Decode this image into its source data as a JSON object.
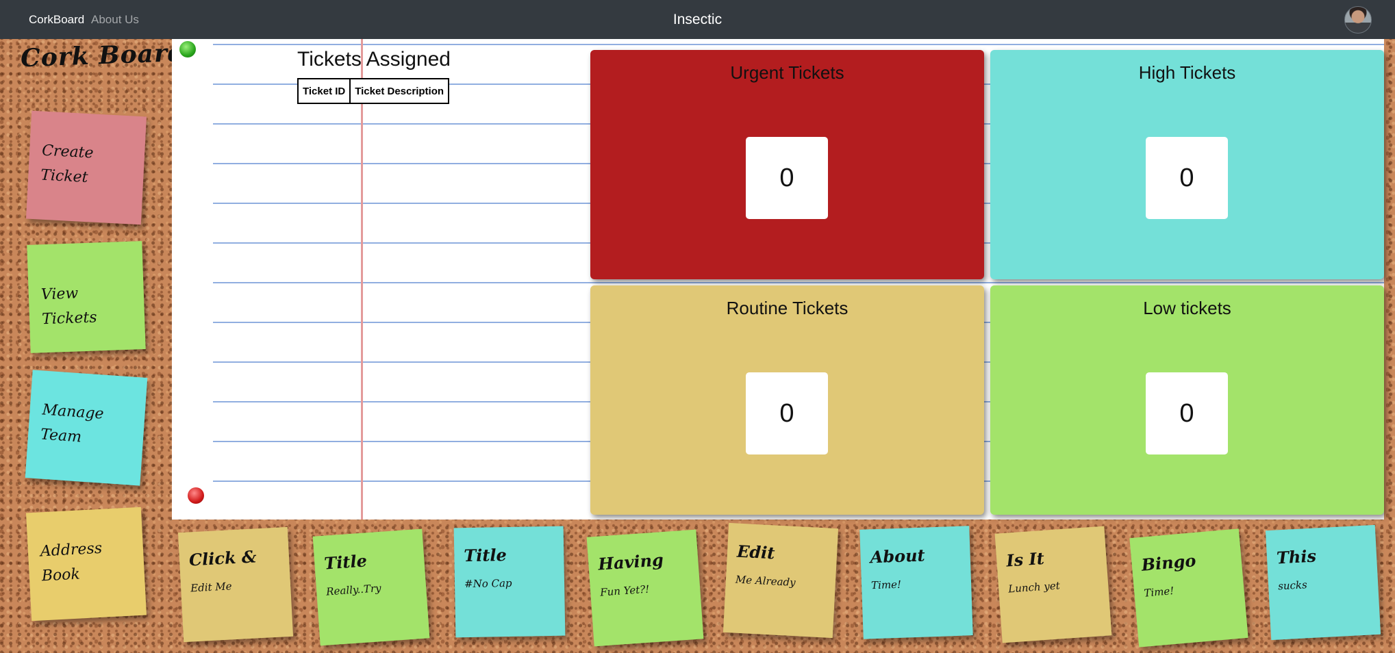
{
  "navbar": {
    "brand": "CorkBoard",
    "about": "About Us",
    "title": "Insectic"
  },
  "sidebar": {
    "title": "Cork Board",
    "notes": [
      {
        "label": "Create Ticket",
        "color": "#d9848a"
      },
      {
        "label": "View Tickets",
        "color": "#a3e36a"
      },
      {
        "label": "Manage Team",
        "color": "#6ce4e0"
      },
      {
        "label": "Address Book",
        "color": "#e8cd6c"
      }
    ]
  },
  "assigned": {
    "title": "Tickets Assigned",
    "columns": [
      "Ticket ID",
      "Ticket Description"
    ]
  },
  "priorities": [
    {
      "label": "Urgent Tickets",
      "count": "0",
      "color": "#b31d1f"
    },
    {
      "label": "High Tickets",
      "count": "0",
      "color": "#74e0d8"
    },
    {
      "label": "Routine Tickets",
      "count": "0",
      "color": "#e0c876"
    },
    {
      "label": "Low tickets",
      "count": "0",
      "color": "#a3e36a"
    }
  ],
  "bottom_notes": [
    {
      "title": "Click &",
      "body": "Edit Me",
      "color": "#e0c876"
    },
    {
      "title": "Title",
      "body": "Really..Try",
      "color": "#a3e36a"
    },
    {
      "title": "Title",
      "body": "#No Cap",
      "color": "#74e0d8"
    },
    {
      "title": "Having",
      "body": "Fun Yet?!",
      "color": "#a3e36a"
    },
    {
      "title": "Edit",
      "body": "Me Already",
      "color": "#e0c876"
    },
    {
      "title": "About",
      "body": "Time!",
      "color": "#74e0d8"
    },
    {
      "title": "Is It",
      "body": "Lunch yet",
      "color": "#e0c876"
    },
    {
      "title": "Bingo",
      "body": "Time!",
      "color": "#a3e36a"
    },
    {
      "title": "This",
      "body": "sucks",
      "color": "#74e0d8"
    }
  ]
}
